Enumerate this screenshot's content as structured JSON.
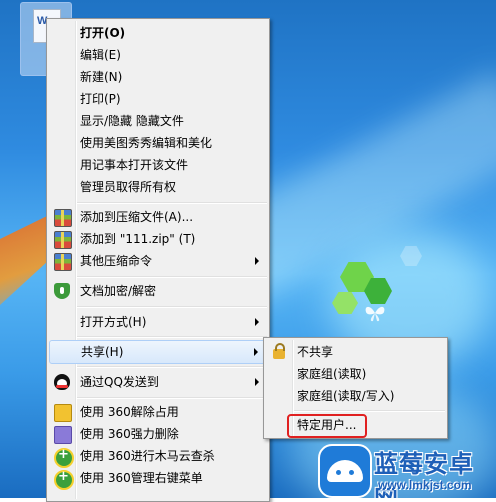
{
  "desktop": {
    "file_icon_letter": "W",
    "watermark_title": "蓝莓安卓网",
    "watermark_url": "www.lmkjst.com"
  },
  "context_menu": {
    "items": [
      {
        "label": "打开(O)"
      },
      {
        "label": "编辑(E)"
      },
      {
        "label": "新建(N)"
      },
      {
        "label": "打印(P)"
      },
      {
        "label": "显示/隐藏 隐藏文件"
      },
      {
        "label": "使用美图秀秀编辑和美化"
      },
      {
        "label": "用记事本打开该文件"
      },
      {
        "label": "管理员取得所有权"
      },
      {
        "label": "添加到压缩文件(A)...",
        "icon": "winrar-icon"
      },
      {
        "label": "添加到 \"111.zip\" (T)",
        "icon": "winrar-icon"
      },
      {
        "label": "其他压缩命令",
        "icon": "winrar-icon"
      },
      {
        "label": "文档加密/解密",
        "icon": "shield-icon"
      },
      {
        "label": "打开方式(H)"
      },
      {
        "label": "共享(H)"
      },
      {
        "label": "通过QQ发送到",
        "icon": "qq-icon"
      },
      {
        "label": "使用 360解除占用",
        "icon": "360-unlock-icon"
      },
      {
        "label": "使用 360强力删除",
        "icon": "360-shred-icon"
      },
      {
        "label": "使用 360进行木马云查杀",
        "icon": "360-scan-icon"
      },
      {
        "label": "使用 360管理右键菜单",
        "icon": "360-scan-icon"
      }
    ]
  },
  "share_submenu": {
    "items": [
      {
        "label": "不共享",
        "icon": "lock-icon"
      },
      {
        "label": "家庭组(读取)"
      },
      {
        "label": "家庭组(读取/写入)"
      },
      {
        "label": "特定用户..."
      }
    ]
  }
}
